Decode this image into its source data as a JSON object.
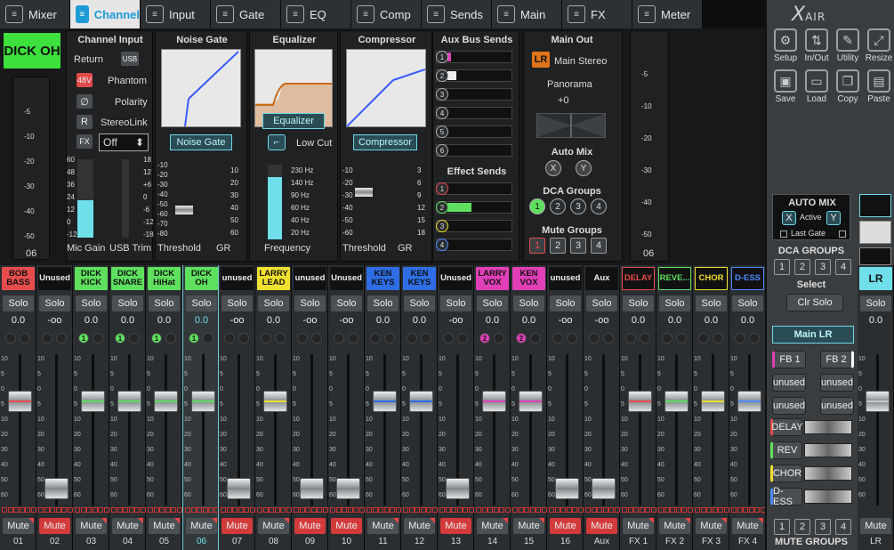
{
  "tabs": [
    {
      "label": "Mixer",
      "icon": "mixer-icon"
    },
    {
      "label": "Channel",
      "icon": "channel-icon"
    },
    {
      "label": "Input",
      "icon": "input-icon"
    },
    {
      "label": "Gate",
      "icon": "gate-icon"
    },
    {
      "label": "EQ",
      "icon": "eq-icon"
    },
    {
      "label": "Comp",
      "icon": "comp-icon"
    },
    {
      "label": "Sends",
      "icon": "sends-icon"
    },
    {
      "label": "Main",
      "icon": "main-icon"
    },
    {
      "label": "FX",
      "icon": "fx-icon"
    },
    {
      "label": "Meter",
      "icon": "meter-icon"
    }
  ],
  "channel_name": "DICK OH",
  "channel_input": {
    "title": "Channel Input",
    "return": "Return",
    "usb": "USB",
    "phantom_btn": "48V",
    "phantom": "Phantom",
    "polarity": "Polarity",
    "stereolink_btn": "R",
    "stereolink": "StereoLink",
    "fx_value": "Off",
    "fx_btn": "FX",
    "mic_gain": "Mic Gain",
    "usb_trim": "USB Trim",
    "left_scale": [
      "60",
      "48",
      "36",
      "24",
      "12",
      "0",
      "-12"
    ],
    "right_scale": [
      "18",
      "12",
      "+6",
      "0",
      "-6",
      "-12",
      "-18"
    ]
  },
  "meter_left": {
    "label": "06",
    "scale": [
      "-5",
      "-10",
      "-20",
      "-30",
      "-40",
      "-50"
    ]
  },
  "noise_gate": {
    "title": "Noise Gate",
    "button": "Noise Gate",
    "threshold": "Threshold",
    "gr": "GR",
    "scale_left": [
      "-10",
      "-20",
      "-30",
      "-40",
      "-50",
      "-60",
      "-70",
      "-80"
    ],
    "scale_right": [
      "10",
      "20",
      "30",
      "40",
      "50",
      "60"
    ]
  },
  "equalizer": {
    "title": "Equalizer",
    "button": "Equalizer",
    "low_cut": "Low Cut",
    "frequency": "Frequency",
    "scale": [
      "230 Hz",
      "140 Hz",
      "90 Hz",
      "60 Hz",
      "40 Hz",
      "20 Hz"
    ]
  },
  "compressor": {
    "title": "Compressor",
    "button": "Compressor",
    "threshold": "Threshold",
    "gr": "GR",
    "scale_left": [
      "-10",
      "-20",
      "-30",
      "-40",
      "-50",
      "-60"
    ],
    "scale_right": [
      "3",
      "6",
      "9",
      "12",
      "15",
      "18"
    ]
  },
  "aux_sends": {
    "title": "Aux Bus Sends",
    "items": [
      "1",
      "2",
      "3",
      "4",
      "5",
      "6"
    ],
    "levels": [
      0.05,
      0.14,
      0,
      0,
      0,
      0
    ]
  },
  "effect_sends": {
    "title": "Effect Sends",
    "items": [
      "1",
      "2",
      "3",
      "4"
    ],
    "levels": [
      0,
      0.38,
      0,
      0
    ]
  },
  "main_out": {
    "title": "Main Out",
    "lr": "LR",
    "stereo": "Main Stereo",
    "panorama": "Panorama",
    "pan_value": "+0",
    "automix": "Auto Mix",
    "am_x": "X",
    "am_y": "Y",
    "dca_groups": "DCA Groups",
    "dca": [
      "1",
      "2",
      "3",
      "4"
    ],
    "mute_groups": "Mute Groups",
    "mg": [
      "1",
      "2",
      "3",
      "4"
    ]
  },
  "meter_right": {
    "label": "06",
    "scale": [
      "-5",
      "-10",
      "-20",
      "-30",
      "-40",
      "-50"
    ]
  },
  "channels": [
    {
      "name": "BOB BASS",
      "bg": "#e74c4c",
      "fg": "#111",
      "db": "0.0",
      "num": "01",
      "mute": false,
      "dca": "",
      "fader": 0.72,
      "color": "#e74c4c"
    },
    {
      "name": "Unused",
      "bg": "#111",
      "fg": "#eee",
      "db": "-oo",
      "num": "02",
      "mute": true,
      "dca": "",
      "fader": 0.05,
      "color": "#888"
    },
    {
      "name": "DICK KICK",
      "bg": "#5ee05e",
      "fg": "#111",
      "db": "0.0",
      "num": "03",
      "mute": false,
      "dca": "1",
      "fader": 0.72,
      "color": "#5ee05e"
    },
    {
      "name": "DICK SNARE",
      "bg": "#5ee05e",
      "fg": "#111",
      "db": "0.0",
      "num": "04",
      "mute": false,
      "dca": "1",
      "fader": 0.72,
      "color": "#5ee05e"
    },
    {
      "name": "DICK HiHat",
      "bg": "#5ee05e",
      "fg": "#111",
      "db": "0.0",
      "num": "05",
      "mute": false,
      "dca": "1",
      "fader": 0.72,
      "color": "#5ee05e"
    },
    {
      "name": "DICK OH",
      "bg": "#5ee05e",
      "fg": "#111",
      "db": "0.0",
      "num": "06",
      "mute": false,
      "dca": "1",
      "fader": 0.72,
      "color": "#5ee05e"
    },
    {
      "name": "unused",
      "bg": "#111",
      "fg": "#eee",
      "db": "-oo",
      "num": "07",
      "mute": true,
      "dca": "",
      "fader": 0.05,
      "color": "#888"
    },
    {
      "name": "LARRY LEAD",
      "bg": "#f0e030",
      "fg": "#111",
      "db": "0.0",
      "num": "08",
      "mute": false,
      "dca": "",
      "fader": 0.72,
      "color": "#f0e030"
    },
    {
      "name": "unused",
      "bg": "#111",
      "fg": "#eee",
      "db": "-oo",
      "num": "09",
      "mute": true,
      "dca": "",
      "fader": 0.05,
      "color": "#888"
    },
    {
      "name": "Unused",
      "bg": "#111",
      "fg": "#eee",
      "db": "-oo",
      "num": "10",
      "mute": true,
      "dca": "",
      "fader": 0.05,
      "color": "#888"
    },
    {
      "name": "KEN KEYS",
      "bg": "#2e6de6",
      "fg": "#111",
      "db": "0.0",
      "num": "11",
      "mute": false,
      "dca": "",
      "fader": 0.72,
      "color": "#2e6de6"
    },
    {
      "name": "KEN KEYS",
      "bg": "#2e6de6",
      "fg": "#111",
      "db": "0.0",
      "num": "12",
      "mute": false,
      "dca": "",
      "fader": 0.72,
      "color": "#2e6de6"
    },
    {
      "name": "Unused",
      "bg": "#111",
      "fg": "#eee",
      "db": "-oo",
      "num": "13",
      "mute": true,
      "dca": "",
      "fader": 0.05,
      "color": "#888"
    },
    {
      "name": "LARRY VOX",
      "bg": "#e03fb8",
      "fg": "#111",
      "db": "0.0",
      "num": "14",
      "mute": false,
      "dca": "2",
      "fader": 0.72,
      "color": "#e03fb8"
    },
    {
      "name": "KEN VOX",
      "bg": "#e03fb8",
      "fg": "#111",
      "db": "0.0",
      "num": "15",
      "mute": false,
      "dca": "2",
      "fader": 0.72,
      "color": "#e03fb8"
    },
    {
      "name": "unused",
      "bg": "#111",
      "fg": "#eee",
      "db": "-oo",
      "num": "16",
      "mute": true,
      "dca": "",
      "fader": 0.05,
      "color": "#888"
    },
    {
      "name": "Aux",
      "bg": "#111",
      "fg": "#eee",
      "db": "-oo",
      "num": "Aux",
      "mute": true,
      "dca": "",
      "fader": 0.05,
      "color": "#888"
    },
    {
      "name": "DELAY",
      "bg": "#111",
      "fg": "#e74c4c",
      "db": "0.0",
      "num": "FX 1",
      "mute": false,
      "dca": "",
      "fader": 0.72,
      "color": "#e74c4c",
      "outline": "#e74c4c"
    },
    {
      "name": "REVE...",
      "bg": "#111",
      "fg": "#5ee05e",
      "db": "0.0",
      "num": "FX 2",
      "mute": false,
      "dca": "",
      "fader": 0.72,
      "color": "#5ee05e",
      "outline": "#5ee05e"
    },
    {
      "name": "CHOR",
      "bg": "#111",
      "fg": "#f0e030",
      "db": "0.0",
      "num": "FX 3",
      "mute": false,
      "dca": "",
      "fader": 0.72,
      "color": "#f0e030",
      "outline": "#f0e030"
    },
    {
      "name": "D-ESS",
      "bg": "#111",
      "fg": "#4b8bff",
      "db": "0.0",
      "num": "FX 4",
      "mute": false,
      "dca": "",
      "fader": 0.72,
      "color": "#4b8bff",
      "outline": "#4b8bff"
    }
  ],
  "fader_scale": [
    "10",
    "5",
    "0",
    "5",
    "10",
    "20",
    "30",
    "40",
    "50",
    "60"
  ],
  "solo_label": "Solo",
  "mute_label": "Mute",
  "sidebar": {
    "logo": "X",
    "logo_sub": "AIR",
    "tools": [
      {
        "label": "Setup",
        "icon": "gear-icon"
      },
      {
        "label": "In/Out",
        "icon": "arrows-icon"
      },
      {
        "label": "Utility",
        "icon": "wrench-icon"
      },
      {
        "label": "Resize",
        "icon": "resize-icon"
      },
      {
        "label": "Save",
        "icon": "save-icon"
      },
      {
        "label": "Load",
        "icon": "folder-icon"
      },
      {
        "label": "Copy",
        "icon": "copy-icon"
      },
      {
        "label": "Paste",
        "icon": "paste-icon"
      }
    ],
    "automix": "AUTO MIX",
    "am_x": "X",
    "am_active": "Active",
    "am_y": "Y",
    "last_gate": "Last Gate",
    "dca_groups": "DCA GROUPS",
    "dca": [
      "1",
      "2",
      "3",
      "4"
    ],
    "select": "Select",
    "clr_solo": "Clr Solo",
    "main_lr": "Main LR",
    "lr_strip": {
      "name": "LR",
      "db": "0.0",
      "num": "LR",
      "fader": 0.72
    },
    "buses": [
      {
        "a": "FB 1",
        "b": "FB 2"
      },
      {
        "a": "unused",
        "b": "unused"
      },
      {
        "a": "unused",
        "b": "unused"
      }
    ],
    "fx": [
      {
        "name": "DELAY",
        "color": "#e74c4c"
      },
      {
        "name": "REV",
        "color": "#5ee05e"
      },
      {
        "name": "CHOR",
        "color": "#f0e030"
      },
      {
        "name": "D-ESS",
        "color": "#4b8bff"
      }
    ],
    "mute_groups": "MUTE GROUPS",
    "mg": [
      "1",
      "2",
      "3",
      "4"
    ]
  }
}
